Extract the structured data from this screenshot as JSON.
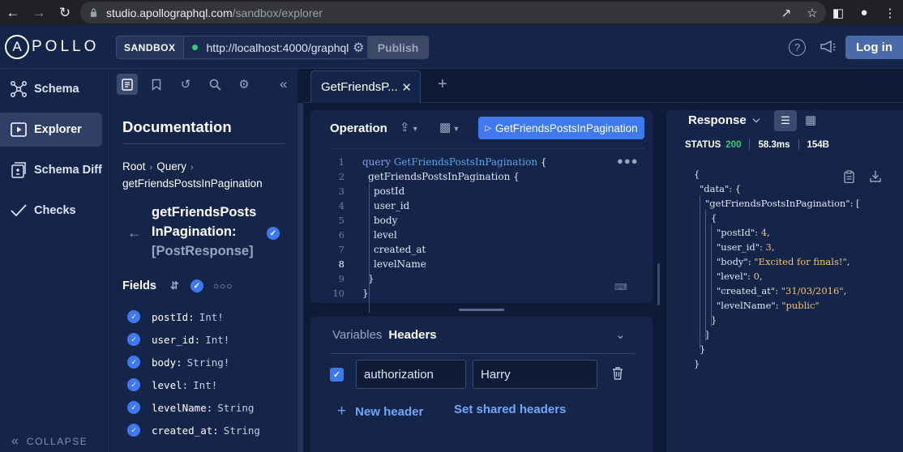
{
  "browser": {
    "url_host": "studio.apollographql.com",
    "url_path": "/sandbox/explorer"
  },
  "header": {
    "logo_text": "POLLO",
    "logo_letter": "A",
    "sandbox_label": "SANDBOX",
    "endpoint": "http://localhost:4000/graphql",
    "publish_label": "Publish",
    "help_label": "?",
    "login_label": "Log in"
  },
  "nav": {
    "items": [
      {
        "label": "Schema",
        "icon": "schema-icon"
      },
      {
        "label": "Explorer",
        "icon": "explorer-icon"
      },
      {
        "label": "Schema Diff",
        "icon": "schema-diff-icon"
      },
      {
        "label": "Checks",
        "icon": "checks-icon"
      }
    ],
    "collapse_label": "COLLAPSE"
  },
  "docs": {
    "title": "Documentation",
    "breadcrumb": [
      "Root",
      "Query",
      "getFriendsPostsInPagination"
    ],
    "type_name_line1": "getFriendsPosts",
    "type_name_line2": "InPagination:",
    "return_type": "[PostResponse]",
    "fields_label": "Fields",
    "fields": [
      {
        "name": "postId:",
        "type": "Int!"
      },
      {
        "name": "user_id:",
        "type": "Int!"
      },
      {
        "name": "body:",
        "type": "String!"
      },
      {
        "name": "level:",
        "type": "Int!"
      },
      {
        "name": "levelName:",
        "type": "String"
      },
      {
        "name": "created_at:",
        "type": "String"
      }
    ]
  },
  "tabs": [
    {
      "label": "GetFriendsP..."
    }
  ],
  "operation": {
    "title": "Operation",
    "run_label": "GetFriendsPostsInPagination",
    "lines": [
      {
        "n": "1",
        "parts": [
          {
            "t": "query ",
            "c": "kw"
          },
          {
            "t": "GetFriendsPostsInPagination",
            "c": "qn"
          },
          {
            "t": " {",
            "c": "fn"
          }
        ]
      },
      {
        "n": "2",
        "parts": [
          {
            "t": "getFriendsPostsInPagination",
            "c": "fn"
          },
          {
            "t": " {",
            "c": "fn"
          }
        ]
      },
      {
        "n": "3",
        "parts": [
          {
            "t": "postId",
            "c": "fn"
          }
        ]
      },
      {
        "n": "4",
        "parts": [
          {
            "t": "user_id",
            "c": "fn"
          }
        ]
      },
      {
        "n": "5",
        "parts": [
          {
            "t": "body",
            "c": "fn"
          }
        ]
      },
      {
        "n": "6",
        "parts": [
          {
            "t": "level",
            "c": "fn"
          }
        ]
      },
      {
        "n": "7",
        "parts": [
          {
            "t": "created_at",
            "c": "fn"
          }
        ]
      },
      {
        "n": "8",
        "parts": [
          {
            "t": "levelName",
            "c": "fn"
          }
        ]
      },
      {
        "n": "9",
        "parts": [
          {
            "t": "}",
            "c": "fn"
          }
        ]
      },
      {
        "n": "10",
        "parts": [
          {
            "t": "}",
            "c": "fn"
          }
        ]
      }
    ],
    "current_line": "8"
  },
  "headers_panel": {
    "variables_label": "Variables",
    "headers_label": "Headers",
    "header_key": "authorization",
    "header_value": "Harry",
    "new_header_label": "New header",
    "shared_headers_label": "Set shared headers"
  },
  "response": {
    "title": "Response",
    "status_label": "STATUS",
    "status_code": "200",
    "time": "58.3ms",
    "size": "154B",
    "lines": [
      {
        "indent": 0,
        "parts": [
          {
            "t": "{",
            "c": "jkey"
          }
        ]
      },
      {
        "indent": 1,
        "parts": [
          {
            "t": "\"data\": {",
            "c": "jkey"
          }
        ]
      },
      {
        "indent": 2,
        "parts": [
          {
            "t": "\"getFriendsPostsInPagination\": [",
            "c": "jkey"
          }
        ]
      },
      {
        "indent": 3,
        "parts": [
          {
            "t": "{",
            "c": "jkey"
          }
        ]
      },
      {
        "indent": 4,
        "parts": [
          {
            "t": "\"postId\": ",
            "c": "jkey"
          },
          {
            "t": "4",
            "c": "jnum"
          },
          {
            "t": ",",
            "c": "jkey"
          }
        ]
      },
      {
        "indent": 4,
        "parts": [
          {
            "t": "\"user_id\": ",
            "c": "jkey"
          },
          {
            "t": "3",
            "c": "jnum"
          },
          {
            "t": ",",
            "c": "jkey"
          }
        ]
      },
      {
        "indent": 4,
        "parts": [
          {
            "t": "\"body\": ",
            "c": "jkey"
          },
          {
            "t": "\"Excited for finals!\"",
            "c": "jstr"
          },
          {
            "t": ",",
            "c": "jkey"
          }
        ]
      },
      {
        "indent": 4,
        "parts": [
          {
            "t": "\"level\": ",
            "c": "jkey"
          },
          {
            "t": "0",
            "c": "jnum"
          },
          {
            "t": ",",
            "c": "jkey"
          }
        ]
      },
      {
        "indent": 4,
        "parts": [
          {
            "t": "\"created_at\": ",
            "c": "jkey"
          },
          {
            "t": "\"31/03/2016\"",
            "c": "jstr"
          },
          {
            "t": ",",
            "c": "jkey"
          }
        ]
      },
      {
        "indent": 4,
        "parts": [
          {
            "t": "\"levelName\": ",
            "c": "jkey"
          },
          {
            "t": "\"public\"",
            "c": "jstr"
          }
        ]
      },
      {
        "indent": 3,
        "parts": [
          {
            "t": "}",
            "c": "jkey"
          }
        ]
      },
      {
        "indent": 2,
        "parts": [
          {
            "t": "]",
            "c": "jkey"
          }
        ]
      },
      {
        "indent": 1,
        "parts": [
          {
            "t": "}",
            "c": "jkey"
          }
        ]
      },
      {
        "indent": 0,
        "parts": [
          {
            "t": "}",
            "c": "jkey"
          }
        ]
      }
    ]
  },
  "colors": {
    "accent": "#3f79f0",
    "success": "#2fcf73",
    "string": "#f4c16b",
    "bg": "#0f1a36",
    "panel": "#15254a"
  }
}
